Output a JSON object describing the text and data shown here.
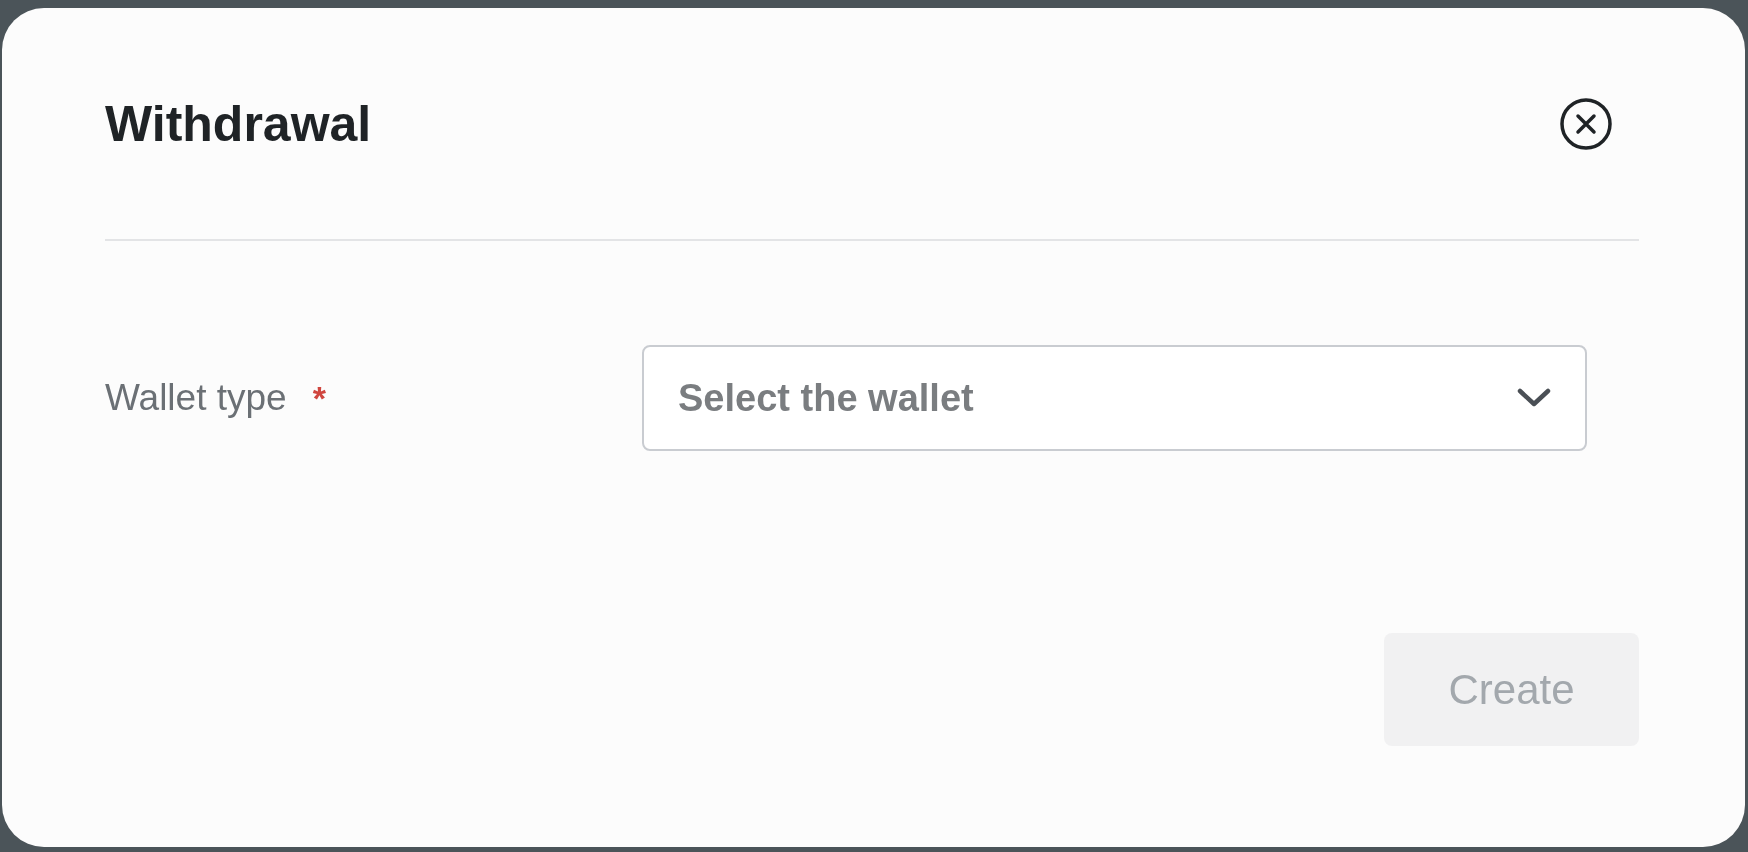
{
  "dialog": {
    "title": "Withdrawal",
    "close_button": true
  },
  "form": {
    "fields": [
      {
        "label": "Wallet type",
        "required_mark": "*",
        "placeholder": "Select the wallet"
      }
    ]
  },
  "buttons": [
    {
      "label": "Create",
      "disabled": true
    }
  ]
}
